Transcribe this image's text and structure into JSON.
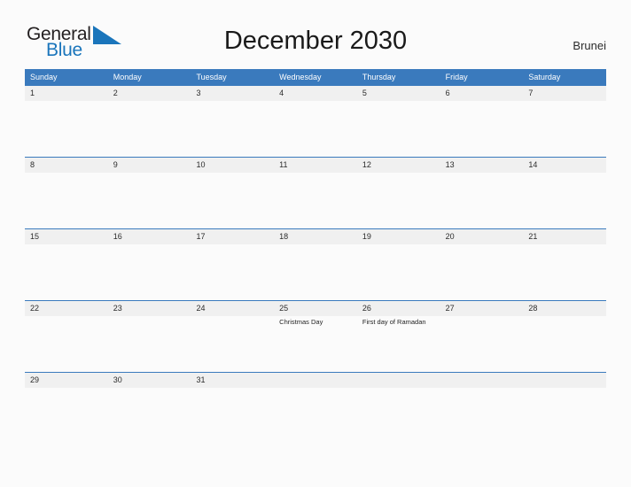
{
  "logo": {
    "word_one": "General",
    "word_two": "Blue",
    "flag_icon": "blue-triangle-flag-icon",
    "brand_color": "#1a75bb"
  },
  "header": {
    "title": "December 2030",
    "region": "Brunei"
  },
  "theme": {
    "header_blue": "#3a7abd",
    "date_band_gray": "#f0f0f0",
    "page_background": "#fbfbfb",
    "text_dark": "#2b2b2b"
  },
  "calendar": {
    "month": "December",
    "year": "2030",
    "weekday_headers": [
      "Sunday",
      "Monday",
      "Tuesday",
      "Wednesday",
      "Thursday",
      "Friday",
      "Saturday"
    ],
    "weeks": [
      {
        "days": [
          {
            "num": "1",
            "events": []
          },
          {
            "num": "2",
            "events": []
          },
          {
            "num": "3",
            "events": []
          },
          {
            "num": "4",
            "events": []
          },
          {
            "num": "5",
            "events": []
          },
          {
            "num": "6",
            "events": []
          },
          {
            "num": "7",
            "events": []
          }
        ]
      },
      {
        "days": [
          {
            "num": "8",
            "events": []
          },
          {
            "num": "9",
            "events": []
          },
          {
            "num": "10",
            "events": []
          },
          {
            "num": "11",
            "events": []
          },
          {
            "num": "12",
            "events": []
          },
          {
            "num": "13",
            "events": []
          },
          {
            "num": "14",
            "events": []
          }
        ]
      },
      {
        "days": [
          {
            "num": "15",
            "events": []
          },
          {
            "num": "16",
            "events": []
          },
          {
            "num": "17",
            "events": []
          },
          {
            "num": "18",
            "events": []
          },
          {
            "num": "19",
            "events": []
          },
          {
            "num": "20",
            "events": []
          },
          {
            "num": "21",
            "events": []
          }
        ]
      },
      {
        "days": [
          {
            "num": "22",
            "events": []
          },
          {
            "num": "23",
            "events": []
          },
          {
            "num": "24",
            "events": []
          },
          {
            "num": "25",
            "events": [
              "Christmas Day"
            ]
          },
          {
            "num": "26",
            "events": [
              "First day of Ramadan"
            ]
          },
          {
            "num": "27",
            "events": []
          },
          {
            "num": "28",
            "events": []
          }
        ]
      },
      {
        "days": [
          {
            "num": "29",
            "events": []
          },
          {
            "num": "30",
            "events": []
          },
          {
            "num": "31",
            "events": []
          },
          {
            "num": "",
            "events": []
          },
          {
            "num": "",
            "events": []
          },
          {
            "num": "",
            "events": []
          },
          {
            "num": "",
            "events": []
          }
        ]
      }
    ]
  }
}
